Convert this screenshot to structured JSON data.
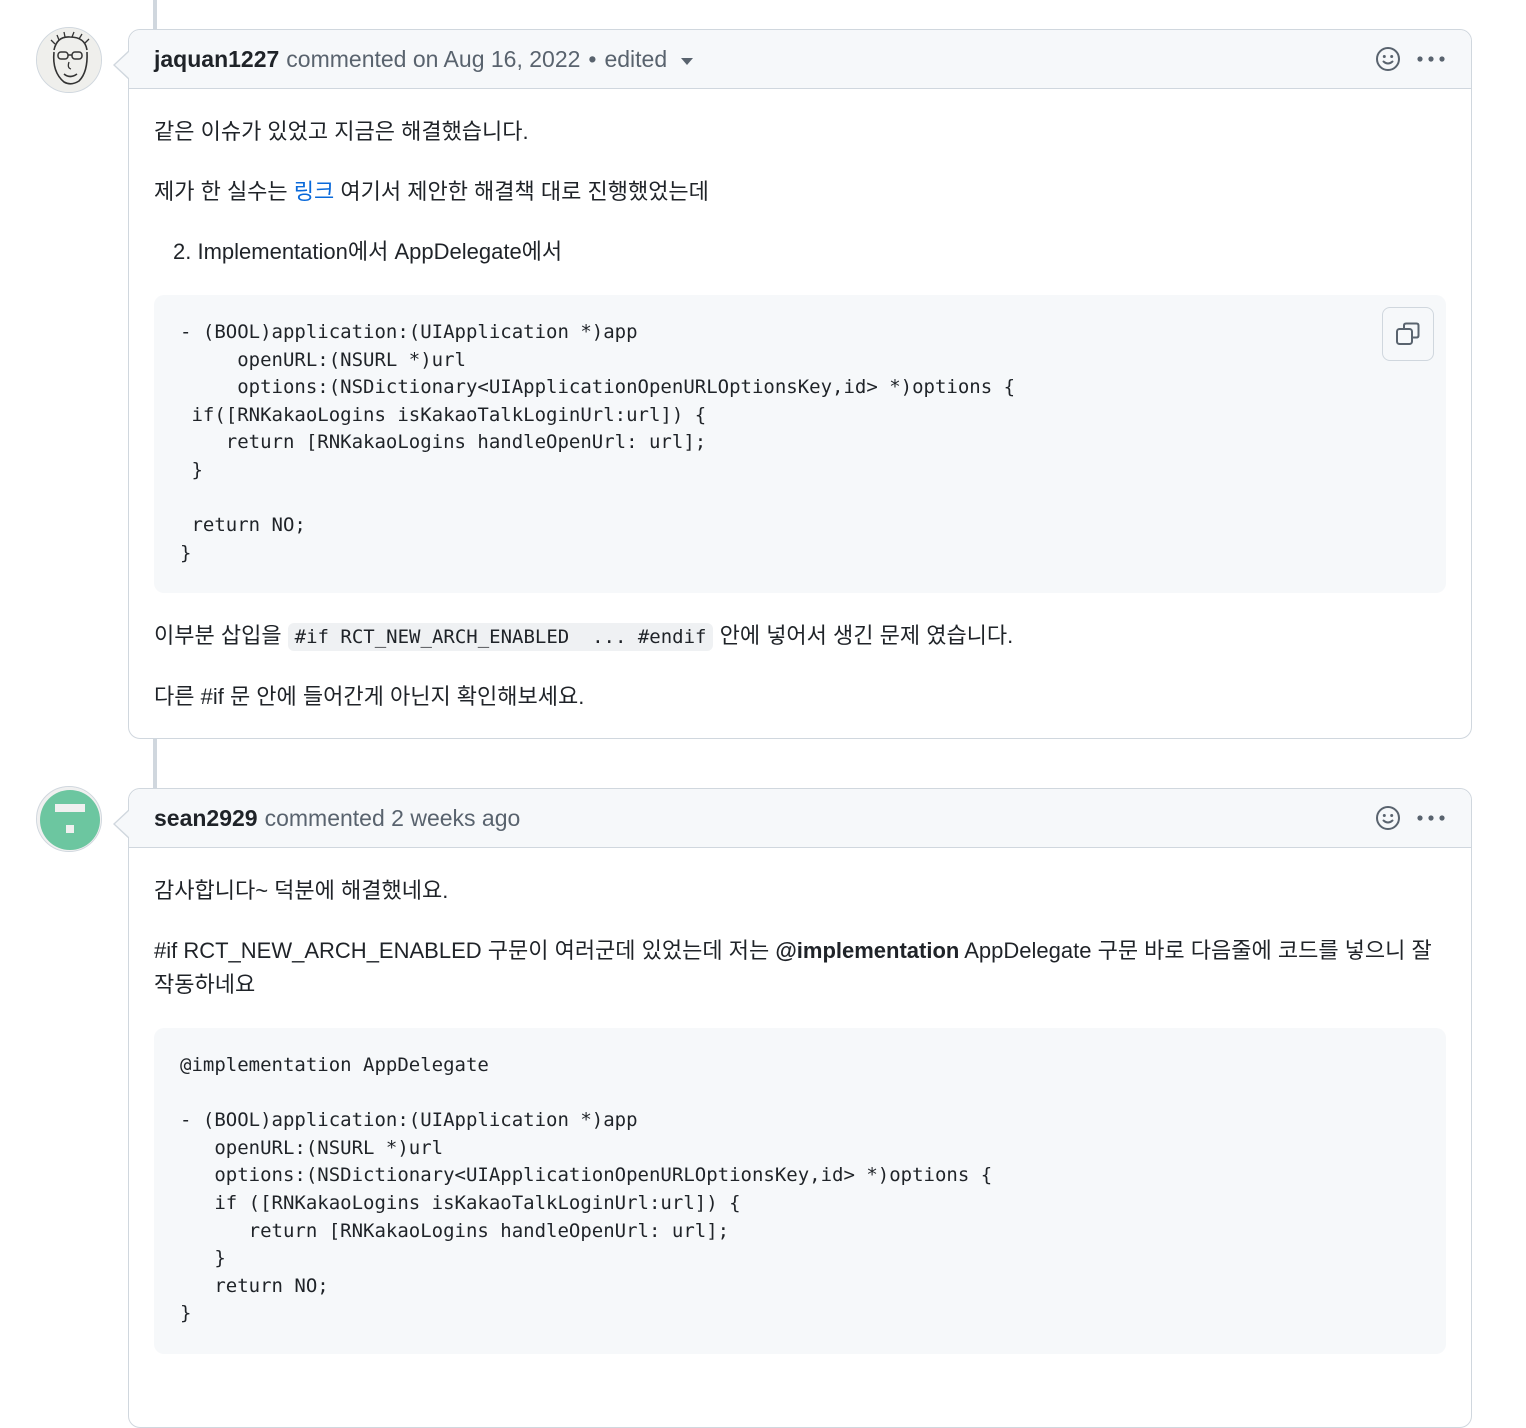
{
  "comments": [
    {
      "author": "jaquan1227",
      "meta": "commented on Aug 16, 2022",
      "edited": "edited",
      "p1": "같은 이슈가 있었고 지금은 해결했습니다.",
      "p2_before": "제가 한 실수는 ",
      "p2_link": "링크",
      "p2_after": " 여기서 제안한 해결책 대로 진행했었는데",
      "list_item": "2. Implementation에서 AppDelegate에서",
      "code": "- (BOOL)application:(UIApplication *)app\n     openURL:(NSURL *)url\n     options:(NSDictionary<UIApplicationOpenURLOptionsKey,id> *)options {\n if([RNKakaoLogins isKakaoTalkLoginUrl:url]) {\n    return [RNKakaoLogins handleOpenUrl: url];\n }\n\n return NO;\n}",
      "p3_before": "이부분 삽입을 ",
      "p3_code": "#if RCT_NEW_ARCH_ENABLED  ... #endif",
      "p3_after": " 안에 넣어서 생긴 문제 였습니다.",
      "p4": "다른 #if 문 안에 들어간게 아닌지 확인해보세요."
    },
    {
      "author": "sean2929",
      "meta": "commented 2 weeks ago",
      "p1": "감사합니다~ 덕분에 해결했네요.",
      "p2_before": "#if RCT_NEW_ARCH_ENABLED 구문이 여러군데 있었는데 저는 ",
      "p2_bold": "@implementation",
      "p2_after": " AppDelegate 구문 바로 다음줄에 코드를 넣으니 잘 작동하네요",
      "code": "@implementation AppDelegate\n\n- (BOOL)application:(UIApplication *)app\n   openURL:(NSURL *)url\n   options:(NSDictionary<UIApplicationOpenURLOptionsKey,id> *)options {\n   if ([RNKakaoLogins isKakaoTalkLoginUrl:url]) {\n      return [RNKakaoLogins handleOpenUrl: url];\n   }\n   return NO;\n}"
    }
  ],
  "colors": {
    "link": "#0969da",
    "header_bg": "#f6f8fa",
    "border": "#d0d7de",
    "identicon": "#6cc6a0"
  },
  "icons": {
    "reaction": "smiley-icon",
    "menu": "kebab-horizontal-icon",
    "copy": "copy-icon"
  }
}
